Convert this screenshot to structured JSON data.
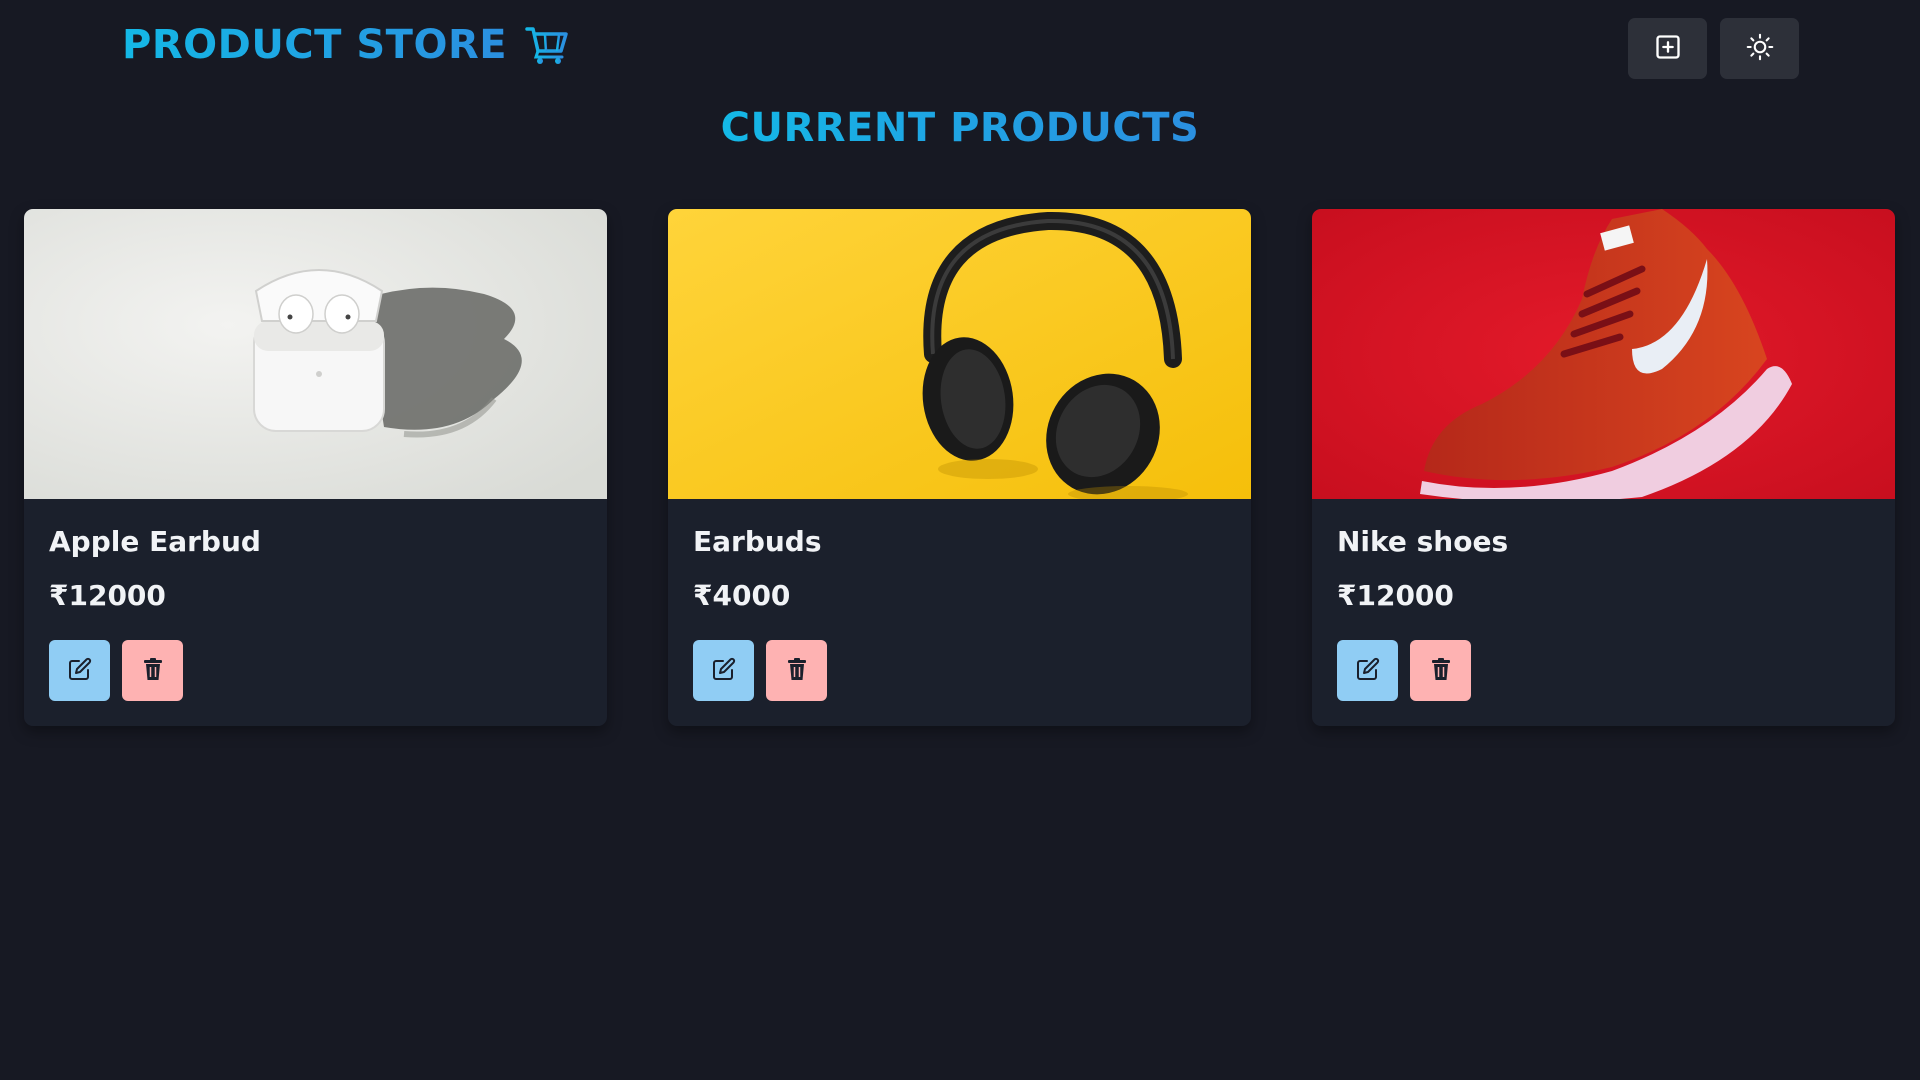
{
  "navbar": {
    "brand_title": "PRODUCT STORE",
    "brand_icon": "shopping-cart-icon",
    "create_button_icon": "plus-square-icon",
    "theme_toggle_icon": "sun-icon"
  },
  "page": {
    "heading": "CURRENT PRODUCTS"
  },
  "products": [
    {
      "name": "Apple Earbud",
      "price": "₹12000",
      "image": "white wireless earbuds in open charging case",
      "edit_icon": "edit-icon",
      "delete_icon": "trash-icon"
    },
    {
      "name": "Earbuds",
      "price": "₹4000",
      "image": "black over-ear headphones on yellow background",
      "edit_icon": "edit-icon",
      "delete_icon": "trash-icon"
    },
    {
      "name": "Nike shoes",
      "price": "₹12000",
      "image": "red Nike running shoe on red background",
      "edit_icon": "edit-icon",
      "delete_icon": "trash-icon"
    }
  ],
  "colors": {
    "background": "#171923",
    "card": "#1b202c",
    "accent_gradient_start": "#14b8e6",
    "accent_gradient_end": "#2b8fe0",
    "edit_button": "#90cdf4",
    "delete_button": "#feb2b2"
  }
}
